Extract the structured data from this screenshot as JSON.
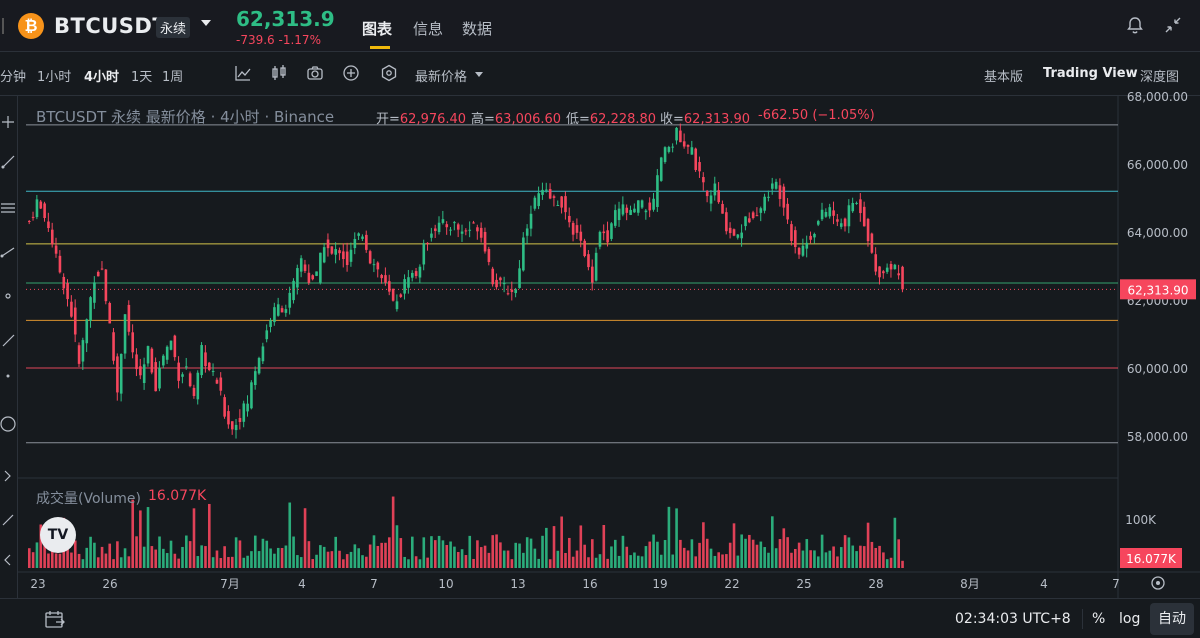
{
  "header": {
    "coin_icon": "₿",
    "symbol": "BTCUSDT",
    "contract_type": "永续",
    "last_price": "62,313.9",
    "price_change": "-739.6",
    "price_change_pct": "-1.17%",
    "tabs": [
      "图表",
      "信息",
      "数据"
    ],
    "active_tab": "图表"
  },
  "toolbar": {
    "intervals": [
      "分钟",
      "1小时",
      "4小时",
      "1天",
      "1周"
    ],
    "active_interval": "4小时",
    "tools": [
      "bar-style-icon",
      "indicator-icon",
      "candle-icon",
      "camera-icon",
      "add-icon",
      "settings-icon"
    ],
    "price_source": "最新价格",
    "views": [
      "基本版",
      "Trading View",
      "深度图"
    ],
    "active_view": "Trading View"
  },
  "legend": {
    "title": "BTCUSDT 永续 最新价格",
    "interval": "4小时",
    "exchange": "Binance",
    "open_label": "开=",
    "open": "62,976.40",
    "high_label": "高=",
    "high": "63,006.60",
    "low_label": "低=",
    "low": "62,228.80",
    "close_label": "收=",
    "close": "62,313.90",
    "change": "-662.50",
    "change_pct": "(−1.05%)"
  },
  "volume": {
    "label": "成交量(Volume)",
    "value": "16.077K",
    "axis_label": "100K"
  },
  "price_axis": {
    "ticks": [
      "68,000.00",
      "66,000.00",
      "64,000.00",
      "62,000.00",
      "60,000.00",
      "58,000.00"
    ],
    "current_price_tag": "62,313.90"
  },
  "time_axis": {
    "ticks": [
      "23",
      "26",
      "7月",
      "4",
      "7",
      "10",
      "13",
      "16",
      "19",
      "22",
      "25",
      "28",
      "8月",
      "4",
      "7"
    ]
  },
  "chart_data": {
    "type": "candlestick",
    "title": "BTCUSDT 永续 最新价格 · 4小时 · Binance",
    "y_range": [
      57200,
      68000
    ],
    "y_ticks": [
      58000,
      60000,
      62000,
      64000,
      66000,
      68000
    ],
    "x_ticks": [
      "23",
      "26",
      "7月",
      "4",
      "7",
      "10",
      "13",
      "16",
      "19",
      "22",
      "25",
      "28",
      "8月",
      "4",
      "7"
    ],
    "horizontal_levels": [
      {
        "price": 67150,
        "color": "#8a8f98"
      },
      {
        "price": 65200,
        "color": "#3fb6c6"
      },
      {
        "price": 63650,
        "color": "#d4c34a"
      },
      {
        "price": 62500,
        "color": "#34a36e"
      },
      {
        "price": 61400,
        "color": "#d9922e"
      },
      {
        "price": 60000,
        "color": "#e0475a"
      },
      {
        "price": 57800,
        "color": "#8a8f98"
      }
    ],
    "close_anchors": [
      [
        0,
        64300
      ],
      [
        2,
        64900
      ],
      [
        5,
        64200
      ],
      [
        7,
        63200
      ],
      [
        9,
        62500
      ],
      [
        11,
        61600
      ],
      [
        13,
        60100
      ],
      [
        15,
        61400
      ],
      [
        17,
        62700
      ],
      [
        19,
        62900
      ],
      [
        21,
        61200
      ],
      [
        23,
        59300
      ],
      [
        25,
        61700
      ],
      [
        27,
        60400
      ],
      [
        29,
        59600
      ],
      [
        31,
        60500
      ],
      [
        33,
        59500
      ],
      [
        35,
        60400
      ],
      [
        37,
        60800
      ],
      [
        39,
        59800
      ],
      [
        41,
        60000
      ],
      [
        43,
        59000
      ],
      [
        45,
        60500
      ],
      [
        47,
        59900
      ],
      [
        49,
        59600
      ],
      [
        51,
        58700
      ],
      [
        53,
        58200
      ],
      [
        55,
        58600
      ],
      [
        57,
        59000
      ],
      [
        59,
        60000
      ],
      [
        61,
        60700
      ],
      [
        63,
        61500
      ],
      [
        65,
        61800
      ],
      [
        67,
        61800
      ],
      [
        69,
        62400
      ],
      [
        71,
        63200
      ],
      [
        73,
        62600
      ],
      [
        75,
        62700
      ],
      [
        77,
        63700
      ],
      [
        79,
        63300
      ],
      [
        81,
        63500
      ],
      [
        83,
        63100
      ],
      [
        85,
        63700
      ],
      [
        87,
        64000
      ],
      [
        89,
        63200
      ],
      [
        91,
        62900
      ],
      [
        93,
        62400
      ],
      [
        95,
        61900
      ],
      [
        97,
        62200
      ],
      [
        99,
        62800
      ],
      [
        101,
        62700
      ],
      [
        103,
        63500
      ],
      [
        105,
        64100
      ],
      [
        107,
        64200
      ],
      [
        109,
        64200
      ],
      [
        111,
        64200
      ],
      [
        113,
        64000
      ],
      [
        115,
        64100
      ],
      [
        117,
        64200
      ],
      [
        119,
        63600
      ],
      [
        121,
        62600
      ],
      [
        123,
        62400
      ],
      [
        125,
        62300
      ],
      [
        127,
        62300
      ],
      [
        129,
        63800
      ],
      [
        131,
        64700
      ],
      [
        133,
        65100
      ],
      [
        135,
        65100
      ],
      [
        137,
        64900
      ],
      [
        139,
        64900
      ],
      [
        141,
        64100
      ],
      [
        143,
        64100
      ],
      [
        145,
        63200
      ],
      [
        147,
        62700
      ],
      [
        149,
        64100
      ],
      [
        151,
        63700
      ],
      [
        153,
        64500
      ],
      [
        155,
        64700
      ],
      [
        157,
        64500
      ],
      [
        159,
        64800
      ],
      [
        161,
        64700
      ],
      [
        163,
        64800
      ],
      [
        165,
        66200
      ],
      [
        167,
        66500
      ],
      [
        169,
        66900
      ],
      [
        171,
        66400
      ],
      [
        173,
        66400
      ],
      [
        175,
        65600
      ],
      [
        177,
        65000
      ],
      [
        179,
        65300
      ],
      [
        181,
        64400
      ],
      [
        183,
        64000
      ],
      [
        185,
        63900
      ],
      [
        187,
        64300
      ],
      [
        189,
        64600
      ],
      [
        191,
        64700
      ],
      [
        193,
        65200
      ],
      [
        195,
        65400
      ],
      [
        197,
        64900
      ],
      [
        199,
        63900
      ],
      [
        201,
        63400
      ],
      [
        203,
        63700
      ],
      [
        205,
        64100
      ],
      [
        207,
        64500
      ],
      [
        209,
        64700
      ],
      [
        211,
        64200
      ],
      [
        213,
        64300
      ],
      [
        215,
        64900
      ],
      [
        217,
        64700
      ],
      [
        219,
        63900
      ],
      [
        221,
        62800
      ],
      [
        223,
        62900
      ],
      [
        225,
        63000
      ],
      [
        227,
        62900
      ],
      [
        228,
        62313.9
      ]
    ],
    "last_candle": {
      "open": 62976.4,
      "high": 63006.6,
      "low": 62228.8,
      "close": 62313.9
    },
    "volume_axis_ticks": [
      "100K"
    ],
    "volume_last": "16.077K"
  },
  "bottom_bar": {
    "clock": "02:34:03 UTC+8",
    "percent": "%",
    "log": "log",
    "auto": "自动"
  },
  "colors": {
    "up": "#2ebd85",
    "down": "#f6465d",
    "accent": "#f0b90b",
    "background": "#161a1e"
  }
}
